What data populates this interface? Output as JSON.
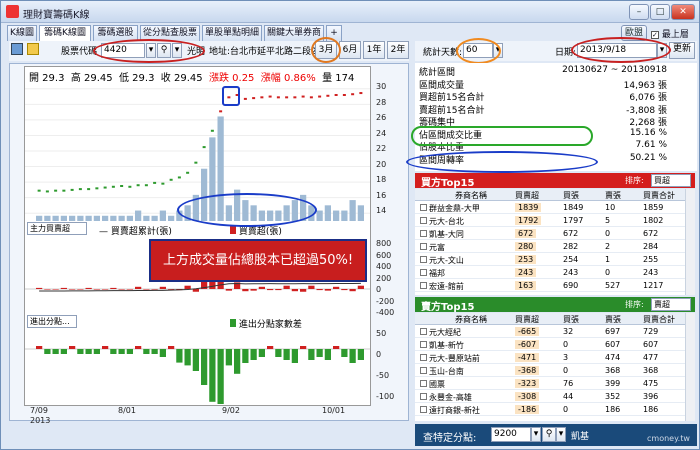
{
  "title": "理財寶籌碼K線",
  "window_btns": {
    "min": "–",
    "max": "□",
    "close": "✕"
  },
  "tabs": [
    "K線圖",
    "籌碼K線圖",
    "籌碼選股",
    "從分點查股票",
    "單股單點明細",
    "關鍵大單券商",
    "+"
  ],
  "check_on_top": "最上層",
  "btn_dock": "歐盟",
  "toolbar": {
    "code_label": "股票代碼",
    "code_value": "4420",
    "name": "光明",
    "address": "地址:台北市延平北路二段202號",
    "periods": [
      "3月",
      "6月",
      "1年",
      "2年"
    ]
  },
  "price_info": {
    "open": "開 29.3",
    "high": "高 29.45",
    "low": "低 29.3",
    "close": "收 29.45",
    "change": "漲跌 0.25",
    "pct": "漲幅 0.86%",
    "vol": "量 174"
  },
  "price_axis": [
    "30",
    "28",
    "26",
    "24",
    "22",
    "20",
    "18",
    "16",
    "14"
  ],
  "mid_axis": [
    "800",
    "600",
    "400",
    "200",
    "0",
    "-200",
    "-400"
  ],
  "low_axis": [
    "50",
    "0",
    "-50",
    "-100"
  ],
  "x_labels": [
    "7/09",
    "8/01",
    "9/02",
    "10/01"
  ],
  "year_label": "2013",
  "mid_select": "主力買賣超",
  "mid_legend1": "— 買賣超累計(張)",
  "mid_legend2": "買賣超(張)",
  "low_select": "進出分點...",
  "low_legend": "進出分點家數差",
  "banner": "上方成交量佔總股本已超過50%!",
  "stats": {
    "days_label": "統計天數:",
    "days": "60",
    "date_label": "日期:",
    "date": "2013/9/18",
    "refresh": "更新"
  },
  "summary": [
    {
      "k": "統計區間",
      "v": "20130627 ~ 20130918"
    },
    {
      "k": "區間成交量",
      "v": "14,963 張"
    },
    {
      "k": "買超前15名合計",
      "v": "6,076 張"
    },
    {
      "k": "賣超前15名合計",
      "v": "-3,808 張"
    },
    {
      "k": "籌碼集中",
      "v": "2,268 張"
    },
    {
      "k": "佔區間成交比重",
      "v": "15.16 %"
    },
    {
      "k": "佔股本比重",
      "v": "7.61 %"
    },
    {
      "k": "區間周轉率",
      "v": "50.21 %"
    }
  ],
  "buy": {
    "title": "買方Top15",
    "sort_label": "排序:",
    "sort": "買超",
    "cols": [
      "券商名稱",
      "買賣超",
      "買張",
      "賣張",
      "買賣合計"
    ],
    "rows": [
      [
        "群益金鼎-大甲",
        "1839",
        "1849",
        "10",
        "1859"
      ],
      [
        "元大-台北",
        "1792",
        "1797",
        "5",
        "1802"
      ],
      [
        "凱基-大同",
        "672",
        "672",
        "0",
        "672"
      ],
      [
        "元富",
        "280",
        "282",
        "2",
        "284"
      ],
      [
        "元大-文山",
        "253",
        "254",
        "1",
        "255"
      ],
      [
        "福邦",
        "243",
        "243",
        "0",
        "243"
      ],
      [
        "宏遠-館前",
        "163",
        "690",
        "527",
        "1217"
      ]
    ]
  },
  "sell": {
    "title": "賣方Top15",
    "sort_label": "排序:",
    "sort": "賣超",
    "cols": [
      "券商名稱",
      "買賣超",
      "買張",
      "賣張",
      "買賣合計"
    ],
    "rows": [
      [
        "元大經紀",
        "-665",
        "32",
        "697",
        "729"
      ],
      [
        "凱基-新竹",
        "-607",
        "0",
        "607",
        "607"
      ],
      [
        "元大-豐原站前",
        "-471",
        "3",
        "474",
        "477"
      ],
      [
        "玉山-台南",
        "-368",
        "0",
        "368",
        "368"
      ],
      [
        "國票",
        "-323",
        "76",
        "399",
        "475"
      ],
      [
        "永豐金-高雄",
        "-308",
        "44",
        "352",
        "396"
      ],
      [
        "遠打商銀-新社",
        "-186",
        "0",
        "186",
        "186"
      ]
    ]
  },
  "bottom": {
    "label": "查特定分點:",
    "value": "9200",
    "broker": "凱基",
    "watermark": "cmoney.tw"
  },
  "volumes": [
    1,
    1,
    1,
    1,
    1,
    1,
    1,
    1,
    1,
    1,
    1,
    1,
    2,
    1,
    1,
    2,
    1,
    2,
    3,
    5,
    10,
    16,
    20,
    3,
    6,
    4,
    3,
    2,
    2,
    2,
    3,
    4,
    5,
    3,
    2,
    3,
    2,
    2,
    4,
    3
  ],
  "closes": [
    16.9,
    16.8,
    16.9,
    16.9,
    17,
    17.1,
    17.1,
    17.2,
    17.3,
    17.4,
    17.5,
    17.4,
    17.6,
    17.6,
    17.9,
    17.8,
    18.3,
    18.6,
    19.2,
    20.5,
    22.5,
    24.6,
    27.1,
    28.9,
    29.2,
    28.7,
    28.8,
    28.9,
    29,
    28.9,
    28.9,
    28.9,
    29,
    28.9,
    29,
    29.1,
    29.2,
    29.2,
    29.3,
    29.45
  ]
}
